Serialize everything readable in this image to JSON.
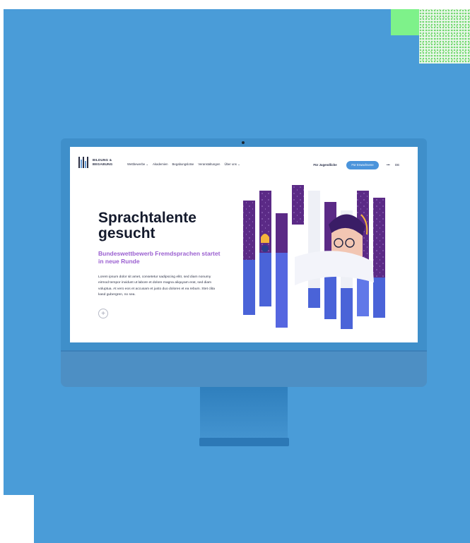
{
  "decor": {
    "background_color": "#4a9cd8",
    "accent_color": "#7ef28a",
    "monitor_color": "#3f8fca"
  },
  "site": {
    "logo_text": "BILDUNG &\nBEGABUNG",
    "nav": {
      "items": [
        "Wettbewerbe ⌄",
        "Akademien",
        "Begabungslotse",
        "Veranstaltungen",
        "Über uns ⌄"
      ],
      "youth_button": "Für Jugendliche",
      "adults_button": "Für Erwachsene",
      "menu_icon": "more-dots-icon",
      "language": "DE"
    },
    "hero": {
      "title": "Sprachtalente gesucht",
      "subtitle": "Bundeswettbewerb Fremdsprachen startet in neue Runde",
      "body": "Lorem ipsum dolor sit amet, consetetur sadipscing elitr, sed diam nonumy eirmod tempor invidunt ut labore et dolore magna aliquyam erat, sed diam voluptua. At vero eos et accusam et justo duo dolores et ea rebum. Stet clita kasd gubergren, no sea.",
      "button_icon": "plus-icon",
      "button_label": "+"
    },
    "colors": {
      "accent_button": "#4b94db",
      "subtitle": "#9a5fd0",
      "illustration_purple": "#5b2a86",
      "illustration_blue": "#4a63d8"
    }
  }
}
